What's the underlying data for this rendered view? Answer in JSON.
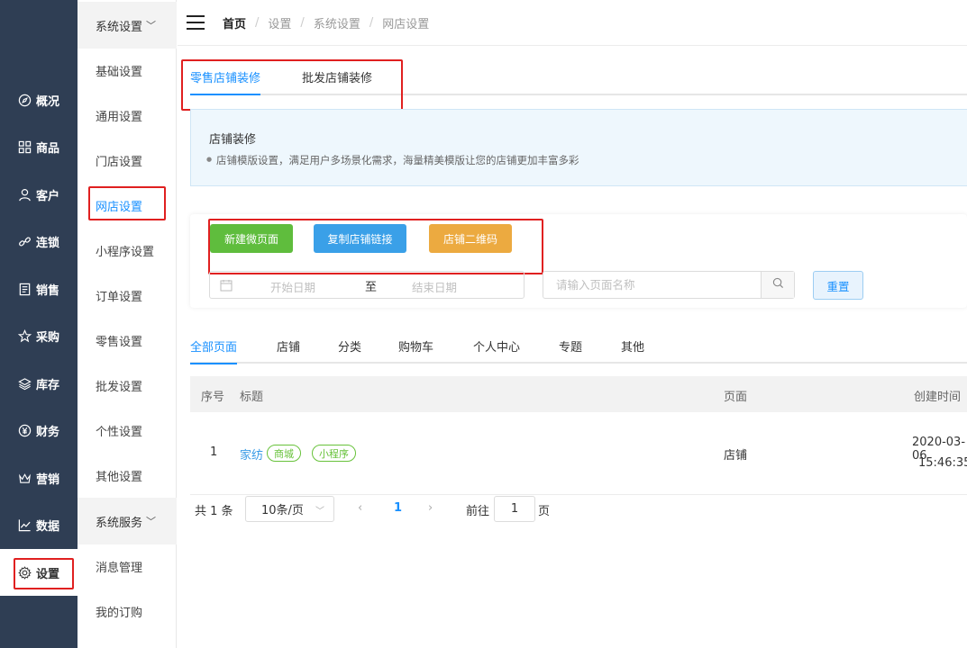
{
  "rail": {
    "items": [
      {
        "label": "概况",
        "icon": "compass-icon"
      },
      {
        "label": "商品",
        "icon": "grid-icon"
      },
      {
        "label": "客户",
        "icon": "user-icon"
      },
      {
        "label": "连锁",
        "icon": "link-icon"
      },
      {
        "label": "销售",
        "icon": "document-icon"
      },
      {
        "label": "采购",
        "icon": "star-icon"
      },
      {
        "label": "库存",
        "icon": "layers-icon"
      },
      {
        "label": "财务",
        "icon": "yen-icon"
      },
      {
        "label": "营销",
        "icon": "crown-icon"
      },
      {
        "label": "数据",
        "icon": "chart-icon"
      },
      {
        "label": "设置",
        "icon": "gear-icon"
      }
    ],
    "active": "设置"
  },
  "submenu": {
    "group1": "系统设置",
    "items": [
      "基础设置",
      "通用设置",
      "门店设置",
      "网店设置",
      "小程序设置",
      "订单设置",
      "零售设置",
      "批发设置",
      "个性设置",
      "其他设置"
    ],
    "active": "网店设置",
    "group2": "系统服务",
    "items2": [
      "消息管理",
      "我的订购"
    ]
  },
  "breadcrumb": [
    "首页",
    "设置",
    "系统设置",
    "网店设置"
  ],
  "tabs": {
    "items": [
      "零售店铺装修",
      "批发店铺装修"
    ],
    "active": "零售店铺装修"
  },
  "notice": {
    "title": "店铺装修",
    "text": "店铺模版设置，满足用户多场景化需求，海量精美模版让您的店铺更加丰富多彩"
  },
  "actions": {
    "new_page": "新建微页面",
    "copy_link": "复制店铺链接",
    "qrcode": "店铺二维码"
  },
  "filters": {
    "start_placeholder": "开始日期",
    "separator": "至",
    "end_placeholder": "结束日期",
    "search_placeholder": "请输入页面名称",
    "reset": "重置"
  },
  "page_tabs": {
    "items": [
      "全部页面",
      "店铺",
      "分类",
      "购物车",
      "个人中心",
      "专题",
      "其他"
    ],
    "active": "全部页面"
  },
  "table": {
    "headers": {
      "index": "序号",
      "title": "标题",
      "page": "页面",
      "created": "创建时间"
    },
    "rows": [
      {
        "index": "1",
        "title": "家纺",
        "tags": [
          "商城",
          "小程序"
        ],
        "page": "店铺",
        "date": "2020-03-06",
        "time": "15:46:35"
      }
    ]
  },
  "pagination": {
    "total": "共 1 条",
    "page_size": "10条/页",
    "current": "1",
    "goto_label": "前往",
    "goto_value": "1",
    "page_suffix": "页"
  },
  "colors": {
    "rail_bg": "#2f3e54",
    "accent": "#1890ff",
    "highlight_box": "#e02020",
    "green": "#5fbd3d",
    "blue": "#3aa0e8",
    "orange": "#ecaa40"
  }
}
